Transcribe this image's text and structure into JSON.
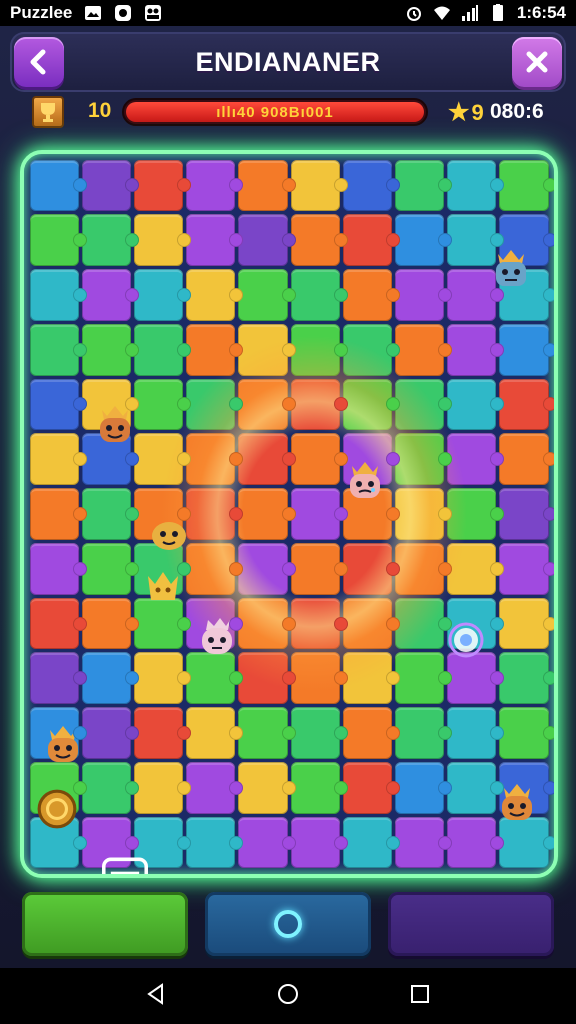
{
  "status_bar": {
    "app_name": "Puzzlee",
    "time": "1:6:54",
    "left_icons": [
      "photo-icon",
      "shield-icon",
      "people-icon"
    ],
    "right_icons": [
      "alarm-icon",
      "wifi-icon",
      "signal-icon",
      "battery-icon"
    ]
  },
  "header": {
    "title": "ENDIANANER",
    "back_icon": "chevron-left-icon",
    "close_icon": "close-icon"
  },
  "info": {
    "level": "10",
    "progress_text": "ıllı40 908Bı001",
    "stars": "9",
    "timer": "080:6"
  },
  "board": {
    "characters": [
      {
        "name": "blue-king",
        "color": "#6aa3c8"
      },
      {
        "name": "orange-king-left",
        "color": "#d87a3a"
      },
      {
        "name": "pink-king-center",
        "color": "#f0b0b0"
      },
      {
        "name": "yellow-blob",
        "color": "#e8b040"
      },
      {
        "name": "yellow-crown",
        "color": "#f0c040"
      },
      {
        "name": "pink-ghost",
        "color": "#f0c8d8"
      },
      {
        "name": "orange-king-lower-left",
        "color": "#e08a3a"
      },
      {
        "name": "coin",
        "color": "#d8982a"
      },
      {
        "name": "orange-king-lower-right",
        "color": "#e0883a"
      }
    ]
  },
  "buttons": {
    "center_icon": "ring-icon"
  },
  "colors": {
    "glow_border": "#8dffb4",
    "progress": "#e02a2a",
    "accent_gold": "#ffd23a",
    "purple_button": "#b45ae0"
  }
}
